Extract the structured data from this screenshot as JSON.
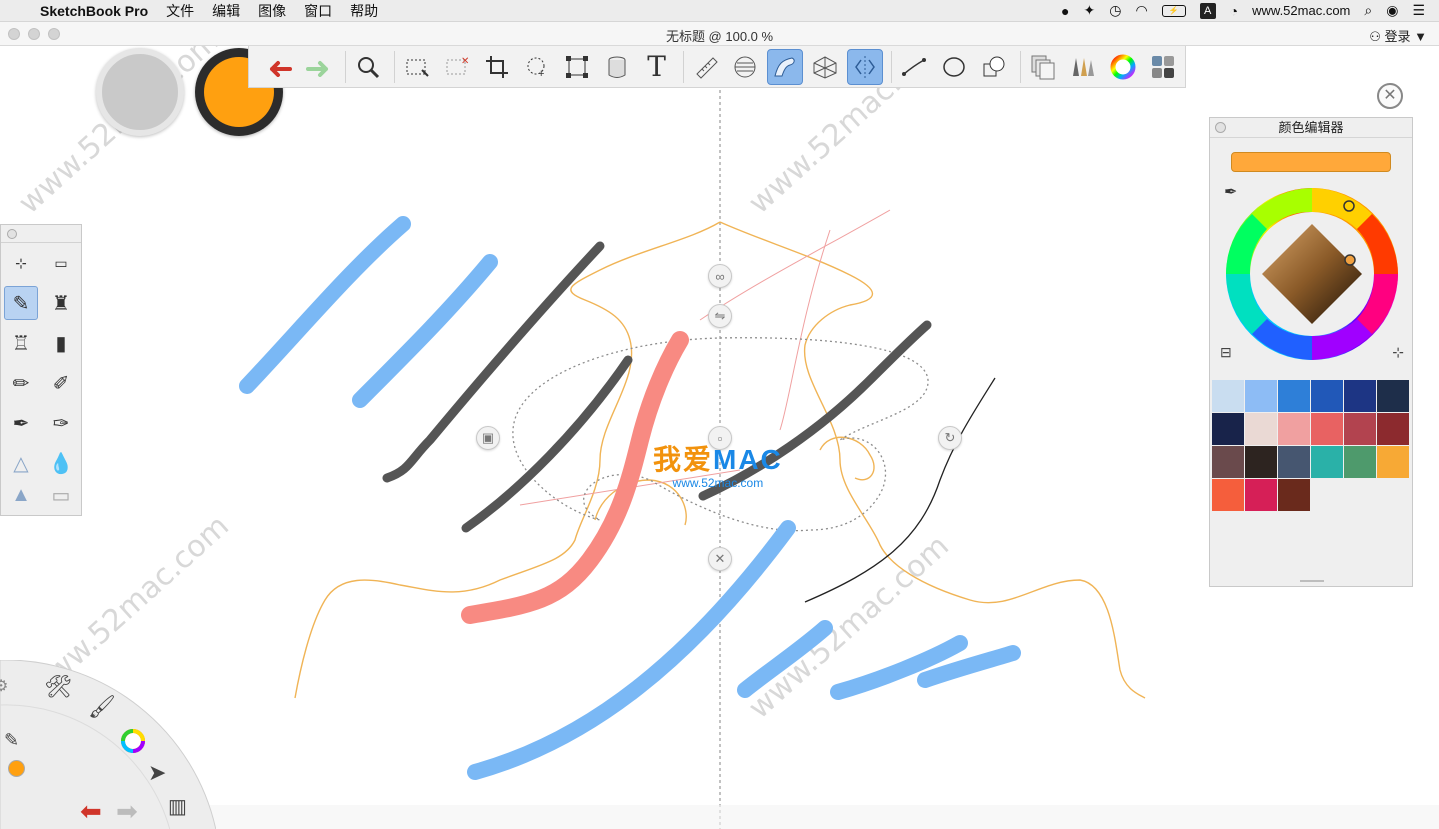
{
  "menubar": {
    "apple_icon": "apple-logo-icon",
    "app_name": "SketchBook Pro",
    "menus": [
      "文件",
      "编辑",
      "图像",
      "窗口",
      "帮助"
    ],
    "status_site": "www.52mac.com"
  },
  "window": {
    "title": "无标题 @ 100.0 %",
    "login_label": "登录 ▼"
  },
  "colors": {
    "current_color": "#ffa010",
    "accent": "#8bb8ec"
  },
  "toolbar": {
    "tools": [
      "undo-icon",
      "redo-icon",
      "zoom-icon",
      "select-icon",
      "clear-selection-icon",
      "crop-icon",
      "lasso-icon",
      "transform-icon",
      "fill-icon",
      "text-icon",
      "ruler-icon",
      "ellipse-guide-icon",
      "french-curve-icon",
      "perspective-icon",
      "symmetry-icon",
      "line-icon",
      "ellipse-icon",
      "shape-icon",
      "layers-icon",
      "brushes-icon",
      "color-wheel-icon",
      "copic-icon"
    ]
  },
  "color_editor": {
    "title": "颜色编辑器",
    "selected_color": "#ffa83a",
    "palette": [
      "#c9ddf0",
      "#8dbcf5",
      "#2e7fd8",
      "#2158b8",
      "#1d3584",
      "#1e2e4a",
      "#18234a",
      "#ead9d4",
      "#f0a0a0",
      "#e86262",
      "#b2434f",
      "#8c2a2e",
      "#6a4a4c",
      "#2d2420",
      "#465670",
      "#2ab1a8",
      "#4e9a6c",
      "#f7a935",
      "#f55e3c",
      "#d61f57",
      "#6a2a1c"
    ]
  },
  "watermark": {
    "logo_cn": "我爱",
    "logo_en": "MAC",
    "logo_url": "www.52mac.com",
    "text": "www.52mac.com"
  }
}
